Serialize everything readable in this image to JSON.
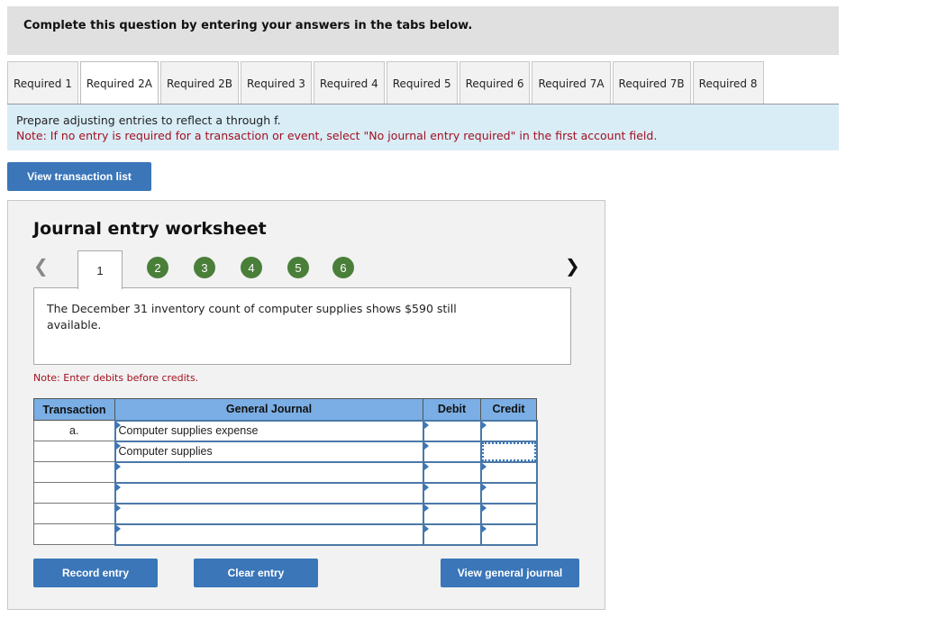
{
  "header": {
    "text": "Complete this question by entering your answers in the tabs below."
  },
  "tabs": [
    {
      "label": "Required 1",
      "active": false
    },
    {
      "label": "Required 2A",
      "active": true
    },
    {
      "label": "Required 2B",
      "active": false
    },
    {
      "label": "Required 3",
      "active": false
    },
    {
      "label": "Required 4",
      "active": false
    },
    {
      "label": "Required 5",
      "active": false
    },
    {
      "label": "Required 6",
      "active": false
    },
    {
      "label": "Required 7A",
      "active": false
    },
    {
      "label": "Required 7B",
      "active": false
    },
    {
      "label": "Required 8",
      "active": false
    }
  ],
  "instructions": {
    "line1": "Prepare adjusting entries to reflect a through f.",
    "line2": "Note: If no entry is required for a transaction or event, select \"No journal entry required\" in the first account field."
  },
  "buttons": {
    "view_transaction_list": "View transaction list",
    "record_entry": "Record entry",
    "clear_entry": "Clear entry",
    "view_general_journal": "View general journal"
  },
  "worksheet": {
    "title": "Journal entry worksheet",
    "prev_icon": "chevron-left-icon",
    "next_icon": "chevron-right-icon",
    "steps": [
      "1",
      "2",
      "3",
      "4",
      "5",
      "6"
    ],
    "active_step": "1",
    "description": "The December 31 inventory count of computer supplies shows $590 still available.",
    "note": "Note: Enter debits before credits.",
    "columns": {
      "transaction": "Transaction",
      "general_journal": "General Journal",
      "debit": "Debit",
      "credit": "Credit"
    },
    "rows": [
      {
        "transaction": "a.",
        "account": "Computer supplies expense",
        "debit": "",
        "credit": ""
      },
      {
        "transaction": "",
        "account": "Computer supplies",
        "debit": "",
        "credit": ""
      },
      {
        "transaction": "",
        "account": "",
        "debit": "",
        "credit": ""
      },
      {
        "transaction": "",
        "account": "",
        "debit": "",
        "credit": ""
      },
      {
        "transaction": "",
        "account": "",
        "debit": "",
        "credit": ""
      },
      {
        "transaction": "",
        "account": "",
        "debit": "",
        "credit": ""
      }
    ]
  },
  "colors": {
    "accent": "#3a76b8",
    "step_green": "#4a7f3a",
    "note_red": "#a3101f",
    "header_blue": "#7aaee4"
  }
}
